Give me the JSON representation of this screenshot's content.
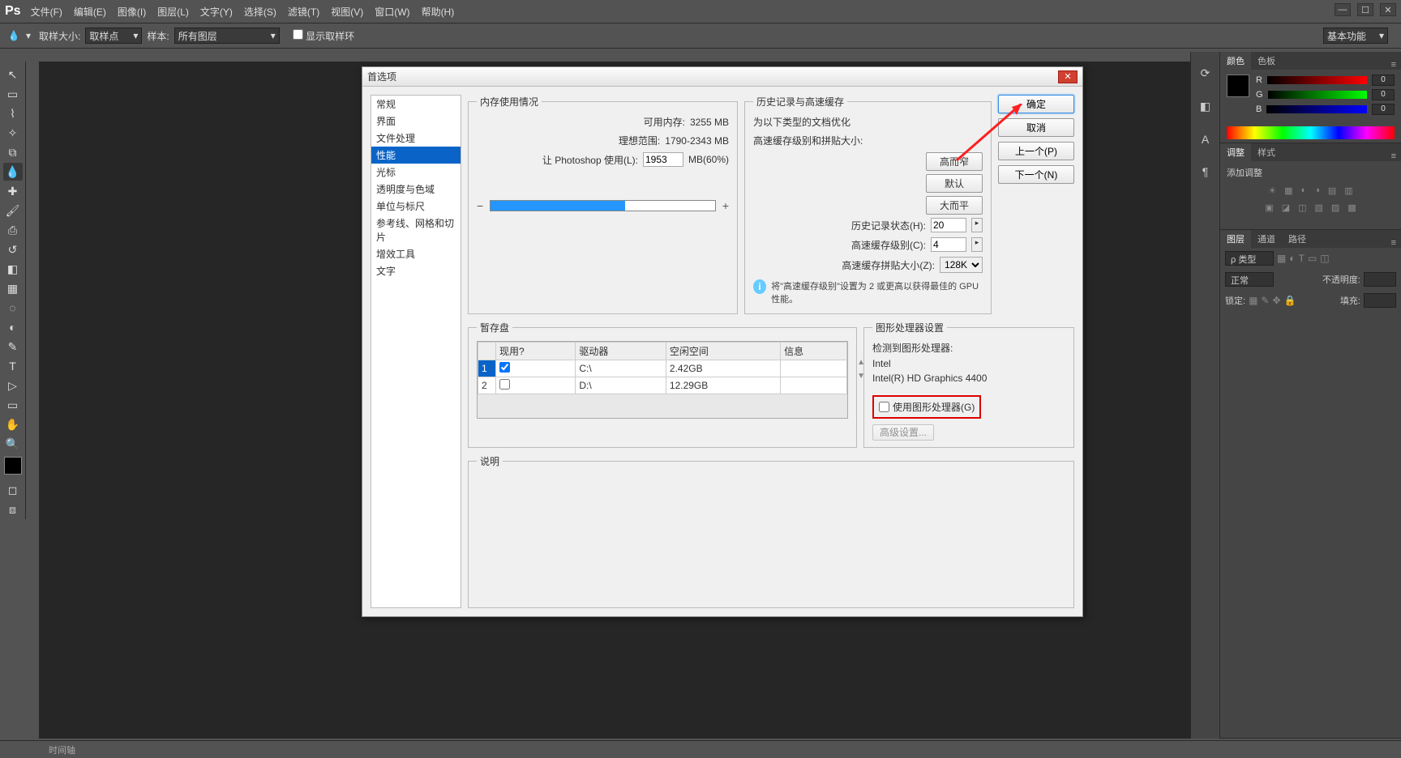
{
  "menu": {
    "items": [
      "文件(F)",
      "编辑(E)",
      "图像(I)",
      "图层(L)",
      "文字(Y)",
      "选择(S)",
      "滤镜(T)",
      "视图(V)",
      "窗口(W)",
      "帮助(H)"
    ],
    "logo": "Ps"
  },
  "optbar": {
    "sample_size_label": "取样大小:",
    "sample_size_value": "取样点",
    "sample_label": "样本:",
    "sample_value": "所有图层",
    "show_sample_ring": "显示取样环",
    "workspace": "基本功能"
  },
  "panels": {
    "color_tabs": [
      "颜色",
      "色板"
    ],
    "r": "R",
    "g": "G",
    "b": "B",
    "val": "0",
    "adjust_tabs": [
      "调整",
      "样式"
    ],
    "adjust_hint": "添加调整",
    "layer_tabs": [
      "图层",
      "通道",
      "路径"
    ],
    "kind_label": "ρ 类型",
    "blend": "正常",
    "opacity_label": "不透明度:",
    "lock_label": "锁定:",
    "fill_label": "填充:"
  },
  "status": {
    "timeline": "时间轴"
  },
  "dialog": {
    "title": "首选项",
    "cats": [
      "常规",
      "界面",
      "文件处理",
      "性能",
      "光标",
      "透明度与色域",
      "单位与标尺",
      "参考线、网格和切片",
      "增效工具",
      "文字"
    ],
    "selected_cat": 3,
    "mem": {
      "legend": "内存使用情况",
      "avail_label": "可用内存:",
      "avail_value": "3255 MB",
      "ideal_label": "理想范围:",
      "ideal_value": "1790-2343 MB",
      "use_label": "让 Photoshop 使用(L):",
      "use_value": "1953",
      "use_suffix": "MB(60%)"
    },
    "hist": {
      "legend": "历史记录与高速缓存",
      "hint1": "为以下类型的文档优化",
      "hint2": "高速缓存级别和拼贴大小:",
      "btn_tall": "高而窄",
      "btn_default": "默认",
      "btn_big": "大而平",
      "states_label": "历史记录状态(H):",
      "states_value": "20",
      "cache_label": "高速缓存级别(C):",
      "cache_value": "4",
      "tile_label": "高速缓存拼贴大小(Z):",
      "tile_value": "128K",
      "info": "将\"高速缓存级别\"设置为 2 或更高以获得最佳的 GPU 性能。"
    },
    "btns": {
      "ok": "确定",
      "cancel": "取消",
      "prev": "上一个(P)",
      "next": "下一个(N)"
    },
    "scratch": {
      "legend": "暂存盘",
      "cols": [
        "现用?",
        "驱动器",
        "空闲空间",
        "信息"
      ],
      "rows": [
        {
          "n": "1",
          "active": true,
          "drive": "C:\\",
          "free": "2.42GB",
          "info": ""
        },
        {
          "n": "2",
          "active": false,
          "drive": "D:\\",
          "free": "12.29GB",
          "info": ""
        }
      ]
    },
    "gpu": {
      "legend": "图形处理器设置",
      "detect": "检测到图形处理器:",
      "vendor": "Intel",
      "name": "Intel(R) HD Graphics 4400",
      "use_gpu": "使用图形处理器(G)",
      "advanced": "高级设置..."
    },
    "desc": {
      "legend": "说明"
    }
  }
}
